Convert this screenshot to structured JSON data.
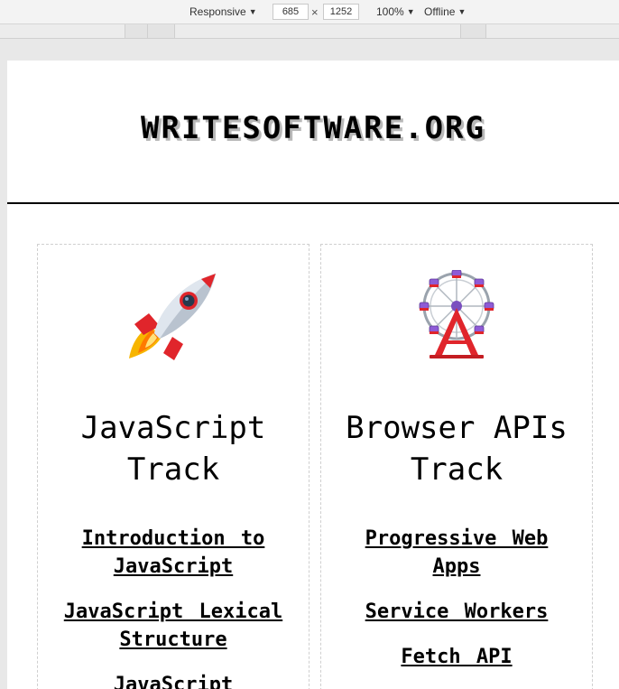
{
  "devtools": {
    "device_mode": "Responsive",
    "width": "685",
    "height": "1252",
    "separator": "×",
    "zoom": "100%",
    "throttle": "Offline"
  },
  "site": {
    "title": "WRITESOFTWARE.ORG"
  },
  "tracks": [
    {
      "icon": "rocket-icon",
      "title_line1": "JavaScript",
      "title_line2": "Track",
      "links": [
        "Introduction to JavaScript",
        "JavaScript Lexical Structure",
        "JavaScript"
      ]
    },
    {
      "icon": "ferris-wheel-icon",
      "title_line1": "Browser APIs",
      "title_line2": "Track",
      "links": [
        "Progressive Web Apps",
        "Service Workers",
        "Fetch API"
      ]
    }
  ],
  "colors": {
    "header_rule": "#000000",
    "title_shadow": "#b8b8b8",
    "card_border": "#cfcfcf"
  }
}
